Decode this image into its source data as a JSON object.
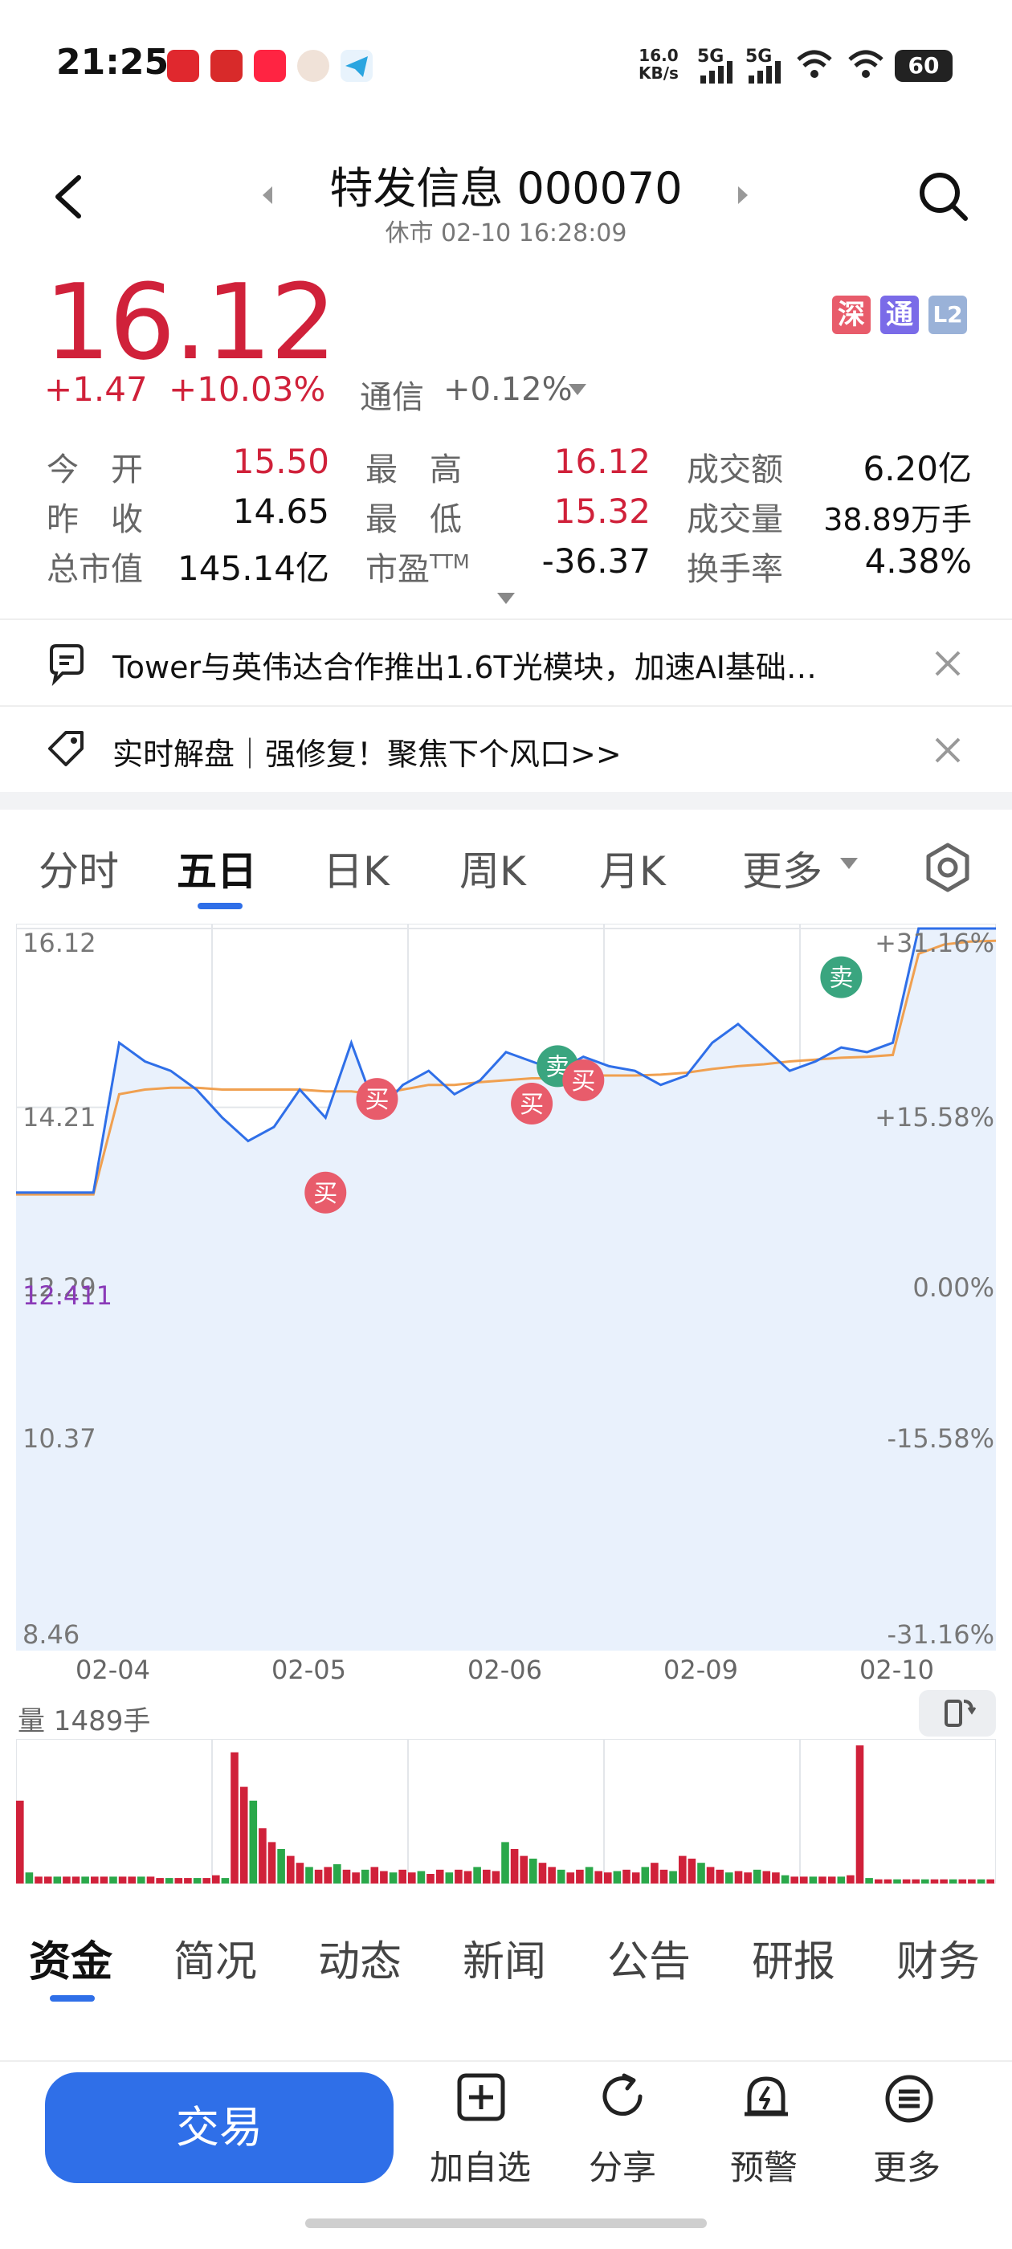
{
  "status": {
    "time": "21:25",
    "net_speed_top": "16.0",
    "net_speed_bottom": "KB/s",
    "signal1": "5G",
    "signal2": "5G",
    "battery": "60",
    "icons": [
      "netease-music-icon",
      "broker-app-icon",
      "xiaohongshu-icon",
      "avatar-app-icon",
      "telegram-icon"
    ]
  },
  "header": {
    "title": "特发信息 000070",
    "subtitle": "休市  02-10 16:28:09"
  },
  "quote": {
    "price": "16.12",
    "change": "+1.47",
    "change_pct": "+10.03%",
    "sector_name": "通信",
    "sector_pct": "+0.12%",
    "tags": [
      "深",
      "通",
      "L2"
    ]
  },
  "stats": [
    {
      "label": "今　开",
      "value": "15.50",
      "red": true
    },
    {
      "label": "最　高",
      "value": "16.12",
      "red": true
    },
    {
      "label": "成交额",
      "value": "6.20亿",
      "red": false
    },
    {
      "label": "昨　收",
      "value": "14.65",
      "red": false
    },
    {
      "label": "最　低",
      "value": "15.32",
      "red": true
    },
    {
      "label": "成交量",
      "value": "38.89万手",
      "red": false
    },
    {
      "label": "总市值",
      "value": "145.14亿",
      "red": false
    },
    {
      "label": "市盈",
      "sup": "TTM",
      "value": "-36.37",
      "red": false
    },
    {
      "label": "换手率",
      "value": "4.38%",
      "red": false
    }
  ],
  "news": [
    {
      "text": "Tower与英伟达合作推出1.6T光模块，加速AI基础…"
    },
    {
      "text": "实时解盘｜强修复！聚焦下个风口>>"
    }
  ],
  "chart_tabs": [
    "分时",
    "五日",
    "日K",
    "周K",
    "月K",
    "更多"
  ],
  "chart_data": {
    "type": "line",
    "title": "",
    "x": [
      "02-04",
      "02-05",
      "02-06",
      "02-09",
      "02-10"
    ],
    "y_ticks_left": [
      "16.12",
      "14.21",
      "12.29",
      "10.37",
      "8.46"
    ],
    "y_ticks_right": [
      "+31.16%",
      "+15.58%",
      "0.00%",
      "-15.58%",
      "-31.16%"
    ],
    "ylim": [
      8.46,
      16.12
    ],
    "ref_line_label": "12.411",
    "series": [
      {
        "values": [
          13.3,
          13.3,
          13.3,
          13.3,
          14.9,
          14.7,
          14.6,
          14.4,
          14.1,
          13.85,
          14.0,
          14.4,
          14.1,
          14.9,
          14.15,
          14.45,
          14.6,
          14.35,
          14.5,
          14.8,
          14.7,
          14.6,
          14.75,
          14.65,
          14.6,
          14.45,
          14.55,
          14.9,
          15.1,
          14.85,
          14.6,
          14.7,
          14.85,
          14.8,
          14.9,
          16.12,
          16.12,
          16.12,
          16.12
        ]
      },
      {
        "values": [
          13.28,
          13.28,
          13.28,
          13.28,
          14.35,
          14.4,
          14.42,
          14.42,
          14.4,
          14.4,
          14.4,
          14.4,
          14.38,
          14.38,
          14.35,
          14.4,
          14.45,
          14.45,
          14.48,
          14.5,
          14.52,
          14.52,
          14.55,
          14.55,
          14.55,
          14.56,
          14.58,
          14.62,
          14.65,
          14.67,
          14.7,
          14.72,
          14.74,
          14.75,
          14.77,
          15.85,
          15.95,
          15.98,
          15.99
        ]
      }
    ],
    "markers": [
      {
        "label": "买",
        "type": "buy",
        "x_index": 12,
        "value": 13.3
      },
      {
        "label": "买",
        "type": "buy",
        "x_index": 14,
        "value": 14.3
      },
      {
        "label": "买",
        "type": "buy",
        "x_index": 20,
        "value": 14.25
      },
      {
        "label": "卖",
        "type": "sell",
        "x_index": 21,
        "value": 14.65
      },
      {
        "label": "买",
        "type": "buy",
        "x_index": 22,
        "value": 14.5
      },
      {
        "label": "卖",
        "type": "sell",
        "x_index": 32,
        "value": 15.6
      }
    ],
    "volume_label": "量 1489手",
    "volume": [
      60,
      8,
      5,
      5,
      5,
      5,
      5,
      5,
      5,
      5,
      5,
      5,
      5,
      5,
      5,
      4,
      4,
      4,
      4,
      4,
      4,
      6,
      4,
      95,
      70,
      60,
      40,
      30,
      25,
      20,
      15,
      12,
      10,
      12,
      14,
      10,
      8,
      10,
      12,
      9,
      8,
      10,
      8,
      9,
      7,
      10,
      8,
      10,
      9,
      12,
      10,
      9,
      30,
      25,
      20,
      18,
      15,
      12,
      10,
      8,
      10,
      12,
      9,
      8,
      9,
      10,
      8,
      12,
      15,
      10,
      9,
      20,
      18,
      15,
      12,
      10,
      8,
      9,
      8,
      10,
      9,
      8,
      6,
      5,
      5,
      5,
      5,
      5,
      5,
      6,
      100,
      4,
      3,
      3,
      3,
      3,
      3,
      3,
      3,
      3,
      3,
      3,
      3,
      3,
      3
    ]
  },
  "bottom_tabs": [
    "资金",
    "简况",
    "动态",
    "新闻",
    "公告",
    "研报",
    "财务"
  ],
  "actions": {
    "trade": "交易",
    "watchlist": "加自选",
    "share": "分享",
    "alert": "预警",
    "more": "更多"
  },
  "colors": {
    "up": "#d0213a",
    "accent": "#2f6fe8",
    "avg": "#f0a050",
    "sell": "#3aa57f"
  }
}
